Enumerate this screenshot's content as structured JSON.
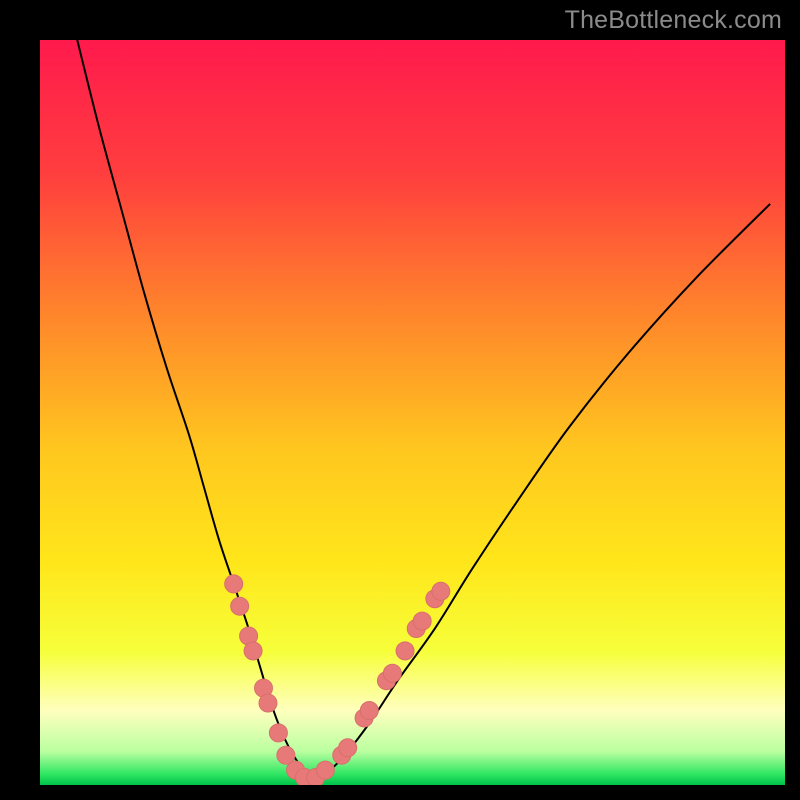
{
  "watermark": "TheBottleneck.com",
  "colors": {
    "black": "#000000",
    "curve": "#000000",
    "marker_fill": "#e77a78",
    "marker_stroke": "#d86f6c",
    "gradient_stops": [
      {
        "offset": 0.0,
        "color": "#ff1a4d"
      },
      {
        "offset": 0.18,
        "color": "#ff3e3e"
      },
      {
        "offset": 0.38,
        "color": "#ff8a2a"
      },
      {
        "offset": 0.55,
        "color": "#ffc71f"
      },
      {
        "offset": 0.7,
        "color": "#ffe61a"
      },
      {
        "offset": 0.82,
        "color": "#f6ff3a"
      },
      {
        "offset": 0.9,
        "color": "#ffffbe"
      },
      {
        "offset": 0.955,
        "color": "#baffa0"
      },
      {
        "offset": 0.985,
        "color": "#30e763"
      },
      {
        "offset": 1.0,
        "color": "#00c24a"
      }
    ]
  },
  "chart_data": {
    "type": "line",
    "title": "",
    "xlabel": "",
    "ylabel": "",
    "xlim": [
      0,
      100
    ],
    "ylim": [
      0,
      100
    ],
    "series": [
      {
        "name": "bottleneck-curve",
        "x": [
          5,
          8,
          11,
          14,
          17,
          20,
          22,
          24,
          26,
          28,
          29.5,
          31,
          32.5,
          34,
          35.5,
          37,
          40,
          44,
          48,
          53,
          58,
          64,
          71,
          79,
          88,
          98
        ],
        "y": [
          100,
          88,
          77,
          66,
          56,
          47,
          40,
          33,
          27,
          21,
          16,
          11,
          7,
          4,
          2,
          1,
          3,
          8,
          14,
          21,
          29,
          38,
          48,
          58,
          68,
          78
        ]
      }
    ],
    "markers": [
      {
        "x": 26.0,
        "y": 27
      },
      {
        "x": 26.8,
        "y": 24
      },
      {
        "x": 28.0,
        "y": 20
      },
      {
        "x": 28.6,
        "y": 18
      },
      {
        "x": 30.0,
        "y": 13
      },
      {
        "x": 30.6,
        "y": 11
      },
      {
        "x": 32.0,
        "y": 7
      },
      {
        "x": 33.0,
        "y": 4
      },
      {
        "x": 34.3,
        "y": 2
      },
      {
        "x": 35.5,
        "y": 1
      },
      {
        "x": 37.0,
        "y": 1
      },
      {
        "x": 38.3,
        "y": 2
      },
      {
        "x": 40.5,
        "y": 4
      },
      {
        "x": 41.3,
        "y": 5
      },
      {
        "x": 43.5,
        "y": 9
      },
      {
        "x": 44.2,
        "y": 10
      },
      {
        "x": 46.5,
        "y": 14
      },
      {
        "x": 47.3,
        "y": 15
      },
      {
        "x": 49.0,
        "y": 18
      },
      {
        "x": 50.5,
        "y": 21
      },
      {
        "x": 51.3,
        "y": 22
      },
      {
        "x": 53.0,
        "y": 25
      },
      {
        "x": 53.8,
        "y": 26
      }
    ]
  }
}
